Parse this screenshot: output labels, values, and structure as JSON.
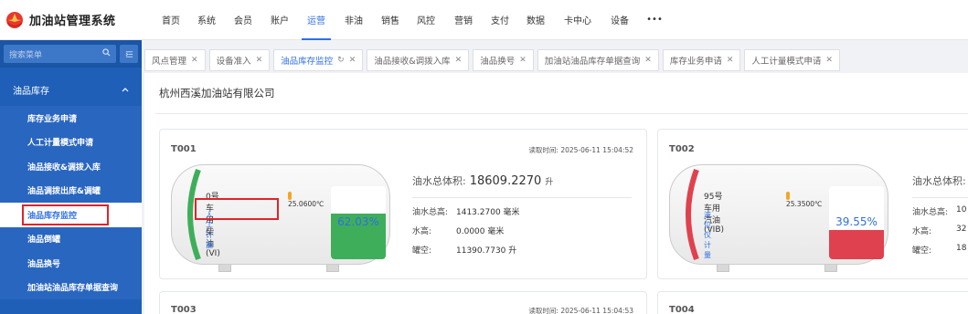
{
  "app": {
    "title": "加油站管理系统",
    "logo_icon": "petrochina-logo"
  },
  "nav": {
    "items": [
      {
        "label": "首页"
      },
      {
        "label": "系统"
      },
      {
        "label": "会员"
      },
      {
        "label": "账户"
      },
      {
        "label": "运营",
        "active": true
      },
      {
        "label": "非油"
      },
      {
        "label": "销售"
      },
      {
        "label": "风控"
      },
      {
        "label": "营销"
      },
      {
        "label": "支付"
      },
      {
        "label": "数据"
      },
      {
        "label": "卡中心"
      },
      {
        "label": "设备"
      },
      {
        "label": "•••"
      }
    ]
  },
  "sidebar": {
    "search_placeholder": "搜索菜单",
    "search_icon": "search-icon",
    "group_label": "油品库存",
    "items": [
      {
        "label": "库存业务申请"
      },
      {
        "label": "人工计量模式申请"
      },
      {
        "label": "油品接收&调拨入库"
      },
      {
        "label": "油品调拨出库&调罐"
      },
      {
        "label": "油品库存监控",
        "active": true
      },
      {
        "label": "油品倒罐"
      },
      {
        "label": "油品换号"
      },
      {
        "label": "加油站油品库存单据查询"
      }
    ]
  },
  "tabs": [
    {
      "label": "风点管理"
    },
    {
      "label": "设备准入"
    },
    {
      "label": "油品库存监控",
      "active": true
    },
    {
      "label": "油品接收&调拨入库"
    },
    {
      "label": "油品换号"
    },
    {
      "label": "加油站油品库存单据查询"
    },
    {
      "label": "库存业务申请"
    },
    {
      "label": "人工计量模式申请"
    }
  ],
  "content": {
    "company": "杭州西溪加油站有限公司",
    "cards": [
      {
        "id": "T001",
        "time": "读取时间: 2025-06-11 15:04:52",
        "oil": "0号 车用柴油(VI)",
        "temp": "25.0600℃",
        "measure_mode": "人工计量",
        "percent": "62.03%",
        "fill_level": 0.62,
        "fill_color": "#3fae5a",
        "total_label": "油水总体积:",
        "total_value": "18609.2270",
        "total_unit": "升",
        "height_label": "油水总高:",
        "height_value": "1413.2700 毫米",
        "water_label": "水高:",
        "water_value": "0.0000 毫米",
        "empty_label": "罐空:",
        "empty_value": "11390.7730 升"
      },
      {
        "id": "T002",
        "time": "",
        "oil": "95号 车用汽油(VIB)",
        "temp": "25.3500℃",
        "measure_mode": "液位仪计量",
        "percent": "39.55%",
        "fill_level": 0.4,
        "fill_color": "#e0414e",
        "total_label": "油水总体积:",
        "height_label": "油水总高:",
        "height_value": "10",
        "water_label": "水高:",
        "water_value": "32",
        "empty_label": "罐空:",
        "empty_value": "18"
      },
      {
        "id": "T003",
        "time": "读取时间: 2025-06-11 15:04:53"
      },
      {
        "id": "T004"
      }
    ]
  }
}
